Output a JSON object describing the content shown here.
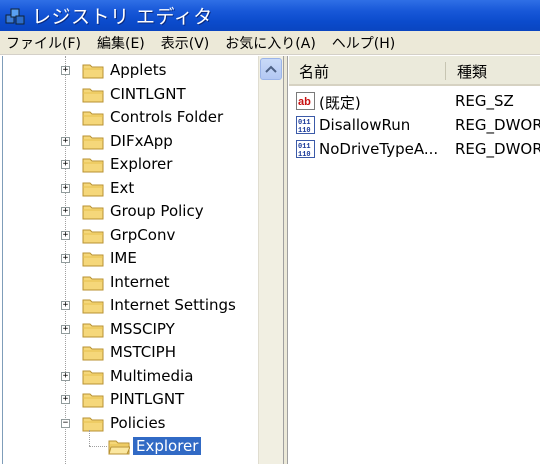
{
  "window": {
    "title": "レジストリ エディタ"
  },
  "menu": [
    "ファイル(F)",
    "編集(E)",
    "表示(V)",
    "お気に入り(A)",
    "ヘルプ(H)"
  ],
  "tree": {
    "items": [
      {
        "label": "Applets",
        "expander": "+"
      },
      {
        "label": "CINTLGNT",
        "expander": ""
      },
      {
        "label": "Controls Folder",
        "expander": ""
      },
      {
        "label": "DIFxApp",
        "expander": "+"
      },
      {
        "label": "Explorer",
        "expander": "+"
      },
      {
        "label": "Ext",
        "expander": "+"
      },
      {
        "label": "Group Policy",
        "expander": "+"
      },
      {
        "label": "GrpConv",
        "expander": "+"
      },
      {
        "label": "IME",
        "expander": "+"
      },
      {
        "label": "Internet",
        "expander": ""
      },
      {
        "label": "Internet Settings",
        "expander": "+"
      },
      {
        "label": "MSSCIPY",
        "expander": "+"
      },
      {
        "label": "MSTCIPH",
        "expander": ""
      },
      {
        "label": "Multimedia",
        "expander": "+"
      },
      {
        "label": "PINTLGNT",
        "expander": "+"
      },
      {
        "label": "Policies",
        "expander": "−"
      }
    ],
    "selected": {
      "label": "Explorer"
    }
  },
  "list": {
    "columns": {
      "name": "名前",
      "type": "種類"
    },
    "rows": [
      {
        "icon": "string-value-icon",
        "name": "(既定)",
        "type": "REG_SZ"
      },
      {
        "icon": "binary-value-icon",
        "name": "DisallowRun",
        "type": "REG_DWORD"
      },
      {
        "icon": "binary-value-icon",
        "name": "NoDriveTypeA...",
        "type": "REG_DWORD"
      }
    ]
  },
  "colors": {
    "titlebar": "#0b4bcc",
    "selection": "#316ac5",
    "menubar": "#ece9d8"
  }
}
